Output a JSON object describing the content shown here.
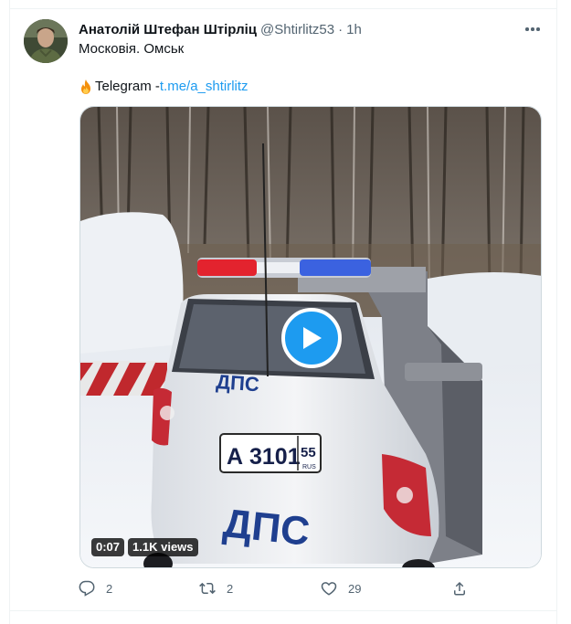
{
  "tweet": {
    "display_name": "Анатолій Штефан Штірліц",
    "handle": "@Shtirlitz53",
    "separator": "·",
    "time": "1h",
    "text_line1": "Московія. Омськ",
    "telegram_label": "Telegram - ",
    "telegram_link": "t.me/a_shtirlitz"
  },
  "media": {
    "duration": "0:07",
    "views": "1.1K views",
    "plate_text": "А 3101",
    "plate_region": "55",
    "plate_country": "RUS",
    "car_label": "ДПС",
    "car_label_upper": "ДПС"
  },
  "actions": {
    "reply_count": "2",
    "retweet_count": "2",
    "like_count": "29"
  },
  "colors": {
    "accent": "#1d9bf0",
    "secondary_text": "#536471",
    "primary_text": "#0f1419"
  },
  "icons": [
    "fire-icon",
    "more-icon",
    "play-icon",
    "reply-icon",
    "retweet-icon",
    "like-icon",
    "share-icon"
  ]
}
